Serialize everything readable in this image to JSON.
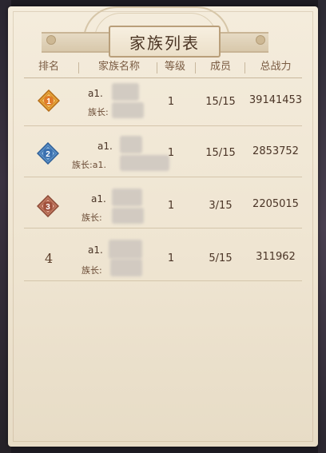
{
  "title": "家族列表",
  "headers": {
    "rank": "排名",
    "name": "家族名称",
    "level": "等级",
    "members": "成员",
    "power": "总战力"
  },
  "rows": [
    {
      "rank": "1",
      "name": "a1.",
      "leader": "族长:",
      "level": "1",
      "members": "15/15",
      "power": "39141453"
    },
    {
      "rank": "2",
      "name": "a1.",
      "leader": "族长:a1.",
      "level": "1",
      "members": "15/15",
      "power": "2853752"
    },
    {
      "rank": "3",
      "name": "a1.",
      "leader": "族长:",
      "level": "1",
      "members": "3/15",
      "power": "2205015"
    },
    {
      "rank": "4",
      "name": "a1.",
      "leader": "族长:",
      "level": "1",
      "members": "5/15",
      "power": "311962"
    }
  ],
  "colors": {
    "rank1": "#e0902a",
    "rank2": "#3a78b8",
    "rank3": "#b06048",
    "text": "#4a3426"
  }
}
